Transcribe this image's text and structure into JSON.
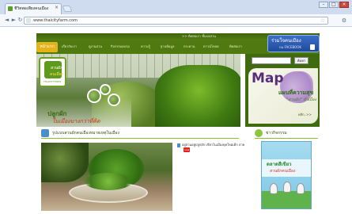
{
  "browser": {
    "tab_title": "ชีวิตพอเพียงคนเมือง",
    "tab_close": "×",
    "url": "www.thaicityfarm.com",
    "win_min": "–",
    "win_max": "□",
    "win_close": "×",
    "back": "◄",
    "forward": "►",
    "reload": "↻",
    "star": "☆",
    "wrench": "⚙"
  },
  "topnav": {
    "small_text": ">> ติดต่อเรา   ชั้นกอสวน",
    "home": "หน้าแรก",
    "items": [
      "เกี่ยวกับเรา",
      "ดูงานสวน",
      "กิจกรรมอบรม",
      "ความรู้",
      "ฐานข้อมูล",
      "กระดาน",
      "ดาวน์โหลด",
      "ติดต่อเรา"
    ]
  },
  "facebook": {
    "title": "ร่วมใจคนเมือง",
    "sub": "บน FACEBOOK"
  },
  "logo": {
    "line1": "สวนผัก",
    "line2": "คนเมือง",
    "sub": "THAICITYFARM"
  },
  "hero": {
    "slogan1": "ปลูกผัก",
    "slogan2": "ในเมืองบางกว่าที่คิด"
  },
  "search": {
    "button": "ค้นหา"
  },
  "map": {
    "title": "Map",
    "sub1": "แผนที่ความสุข",
    "sub2": "\"สวนผัก\" ทั่วเมือง",
    "more": "คลิก..>>"
  },
  "sections": {
    "left_title": "รูปแบบสวนผักคนเมืองหมายเหตุในเมือง",
    "right_title": "ข่าวกิจกรรม"
  },
  "news": {
    "item1": "อยู่สวนอยู่ปลูกผัก เขียวในเมืองยุคใหม่เด็ก สวย",
    "badge": "new"
  },
  "poster": {
    "title": "ตลาดสีเขียว",
    "title2": "สวนผักคนเมือง"
  }
}
